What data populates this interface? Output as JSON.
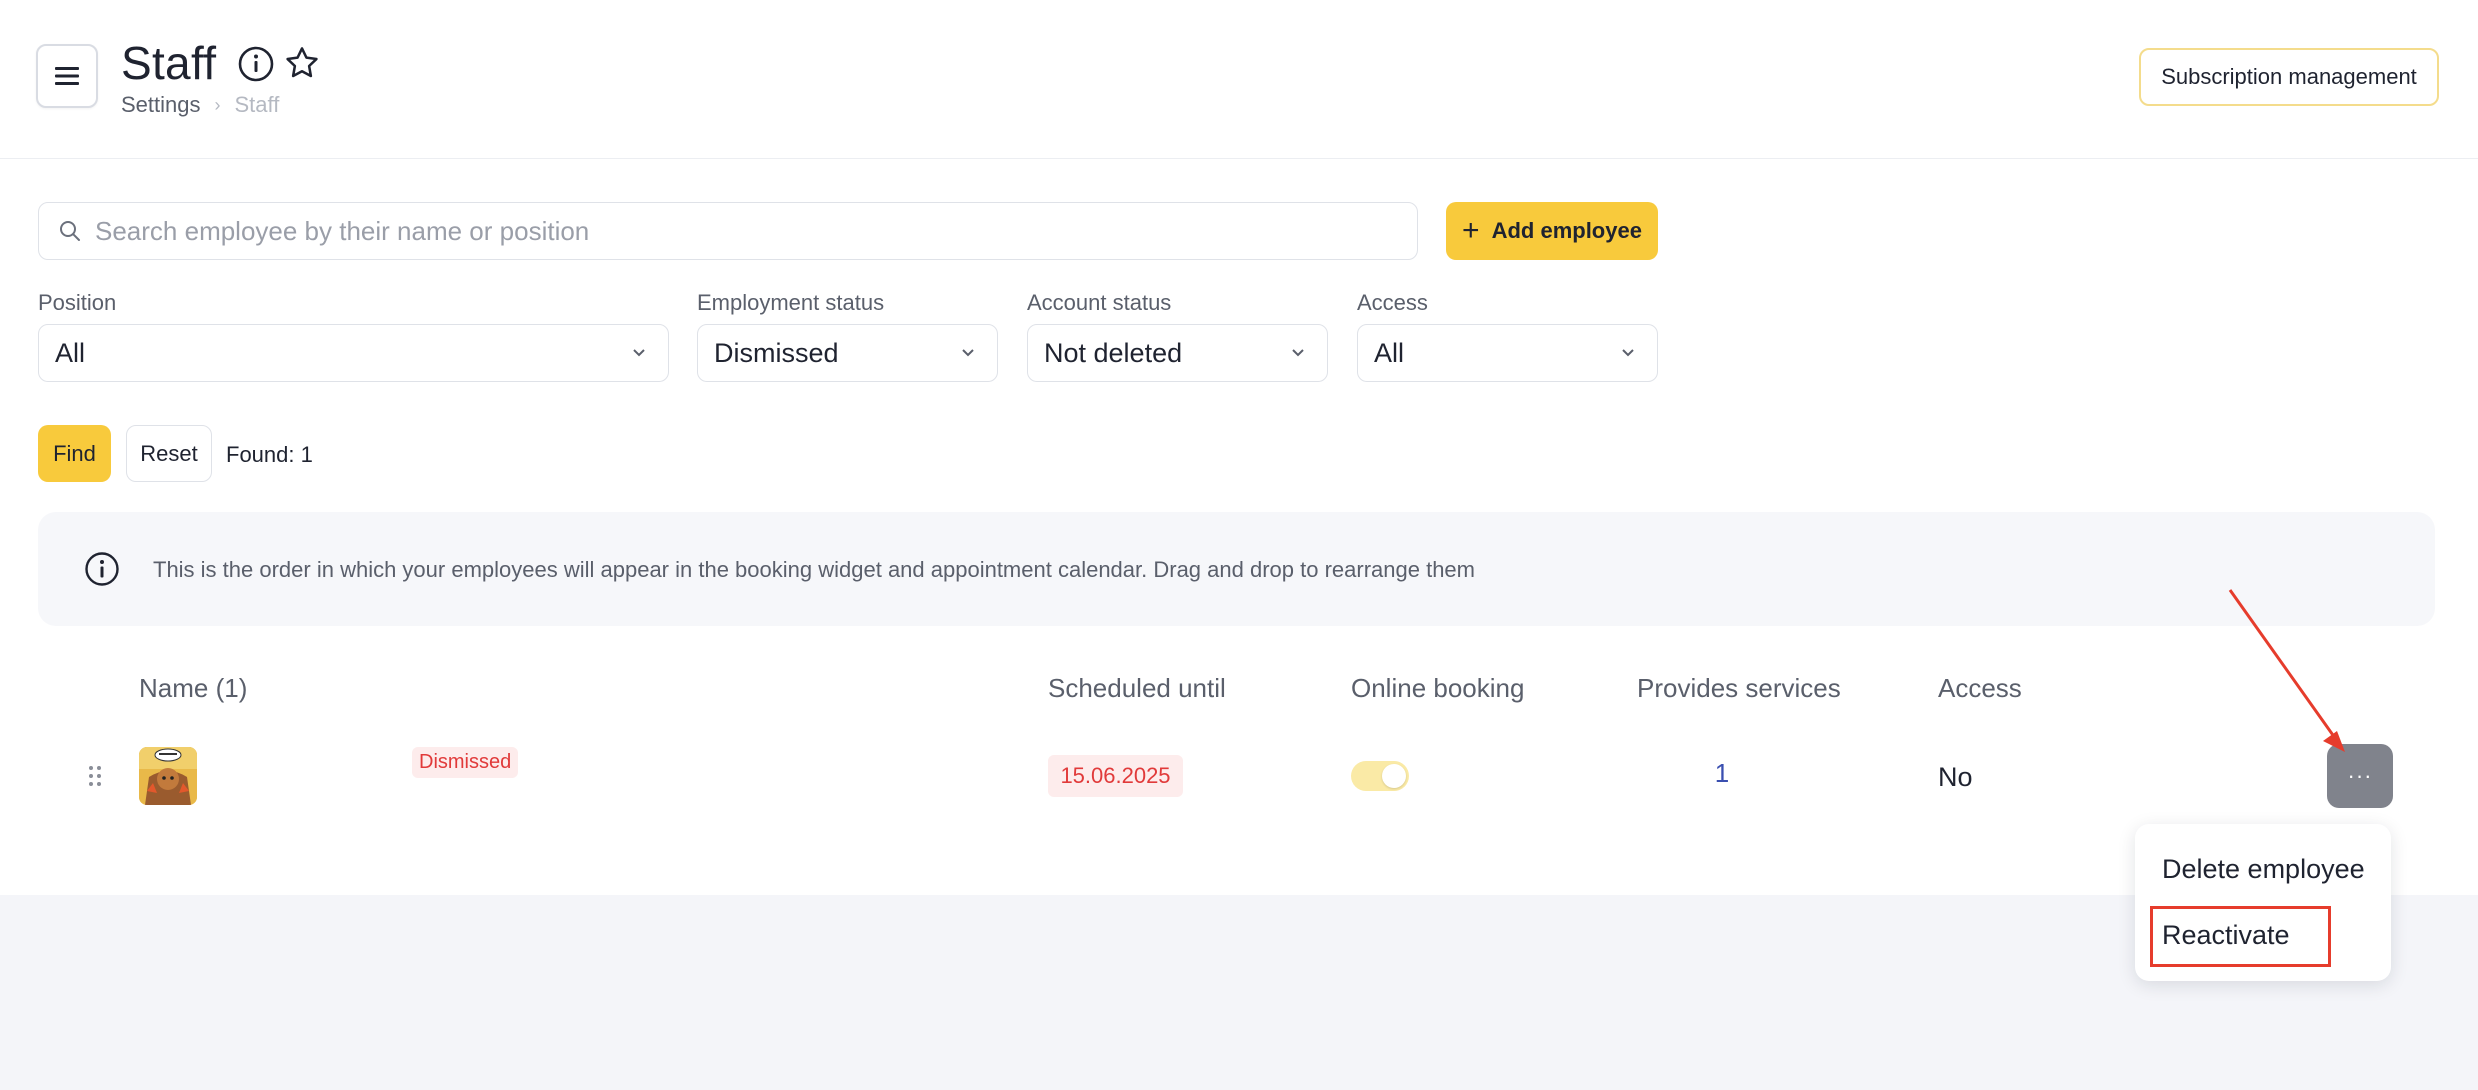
{
  "header": {
    "title": "Staff",
    "breadcrumb": [
      "Settings",
      "Staff"
    ],
    "subscription_button": "Subscription management"
  },
  "search": {
    "placeholder": "Search employee by their name or position",
    "value": ""
  },
  "add_employee_button": "Add employee",
  "filters": [
    {
      "label": "Position",
      "value": "All"
    },
    {
      "label": "Employment status",
      "value": "Dismissed"
    },
    {
      "label": "Account status",
      "value": "Not deleted"
    },
    {
      "label": "Access",
      "value": "All"
    }
  ],
  "actions": {
    "find": "Find",
    "reset": "Reset",
    "found": "Found: 1"
  },
  "banner": {
    "text": "This is the order in which your employees will appear in the booking widget and appointment calendar. Drag and drop to rearrange them"
  },
  "table": {
    "columns": [
      "Name (1)",
      "Scheduled until",
      "Online booking",
      "Provides services",
      "Access"
    ],
    "rows": [
      {
        "status_badge": "Dismissed",
        "scheduled_until": "15.06.2025",
        "online_booking": true,
        "provides_services": "1",
        "access": "No"
      }
    ]
  },
  "row_menu": {
    "more_label": "···",
    "items": [
      "Delete employee",
      "Reactivate"
    ]
  },
  "colors": {
    "accent": "#f8ca3c",
    "danger": "#e13a3a",
    "annotation": "#e63c2c",
    "link": "#3a4fb0"
  }
}
